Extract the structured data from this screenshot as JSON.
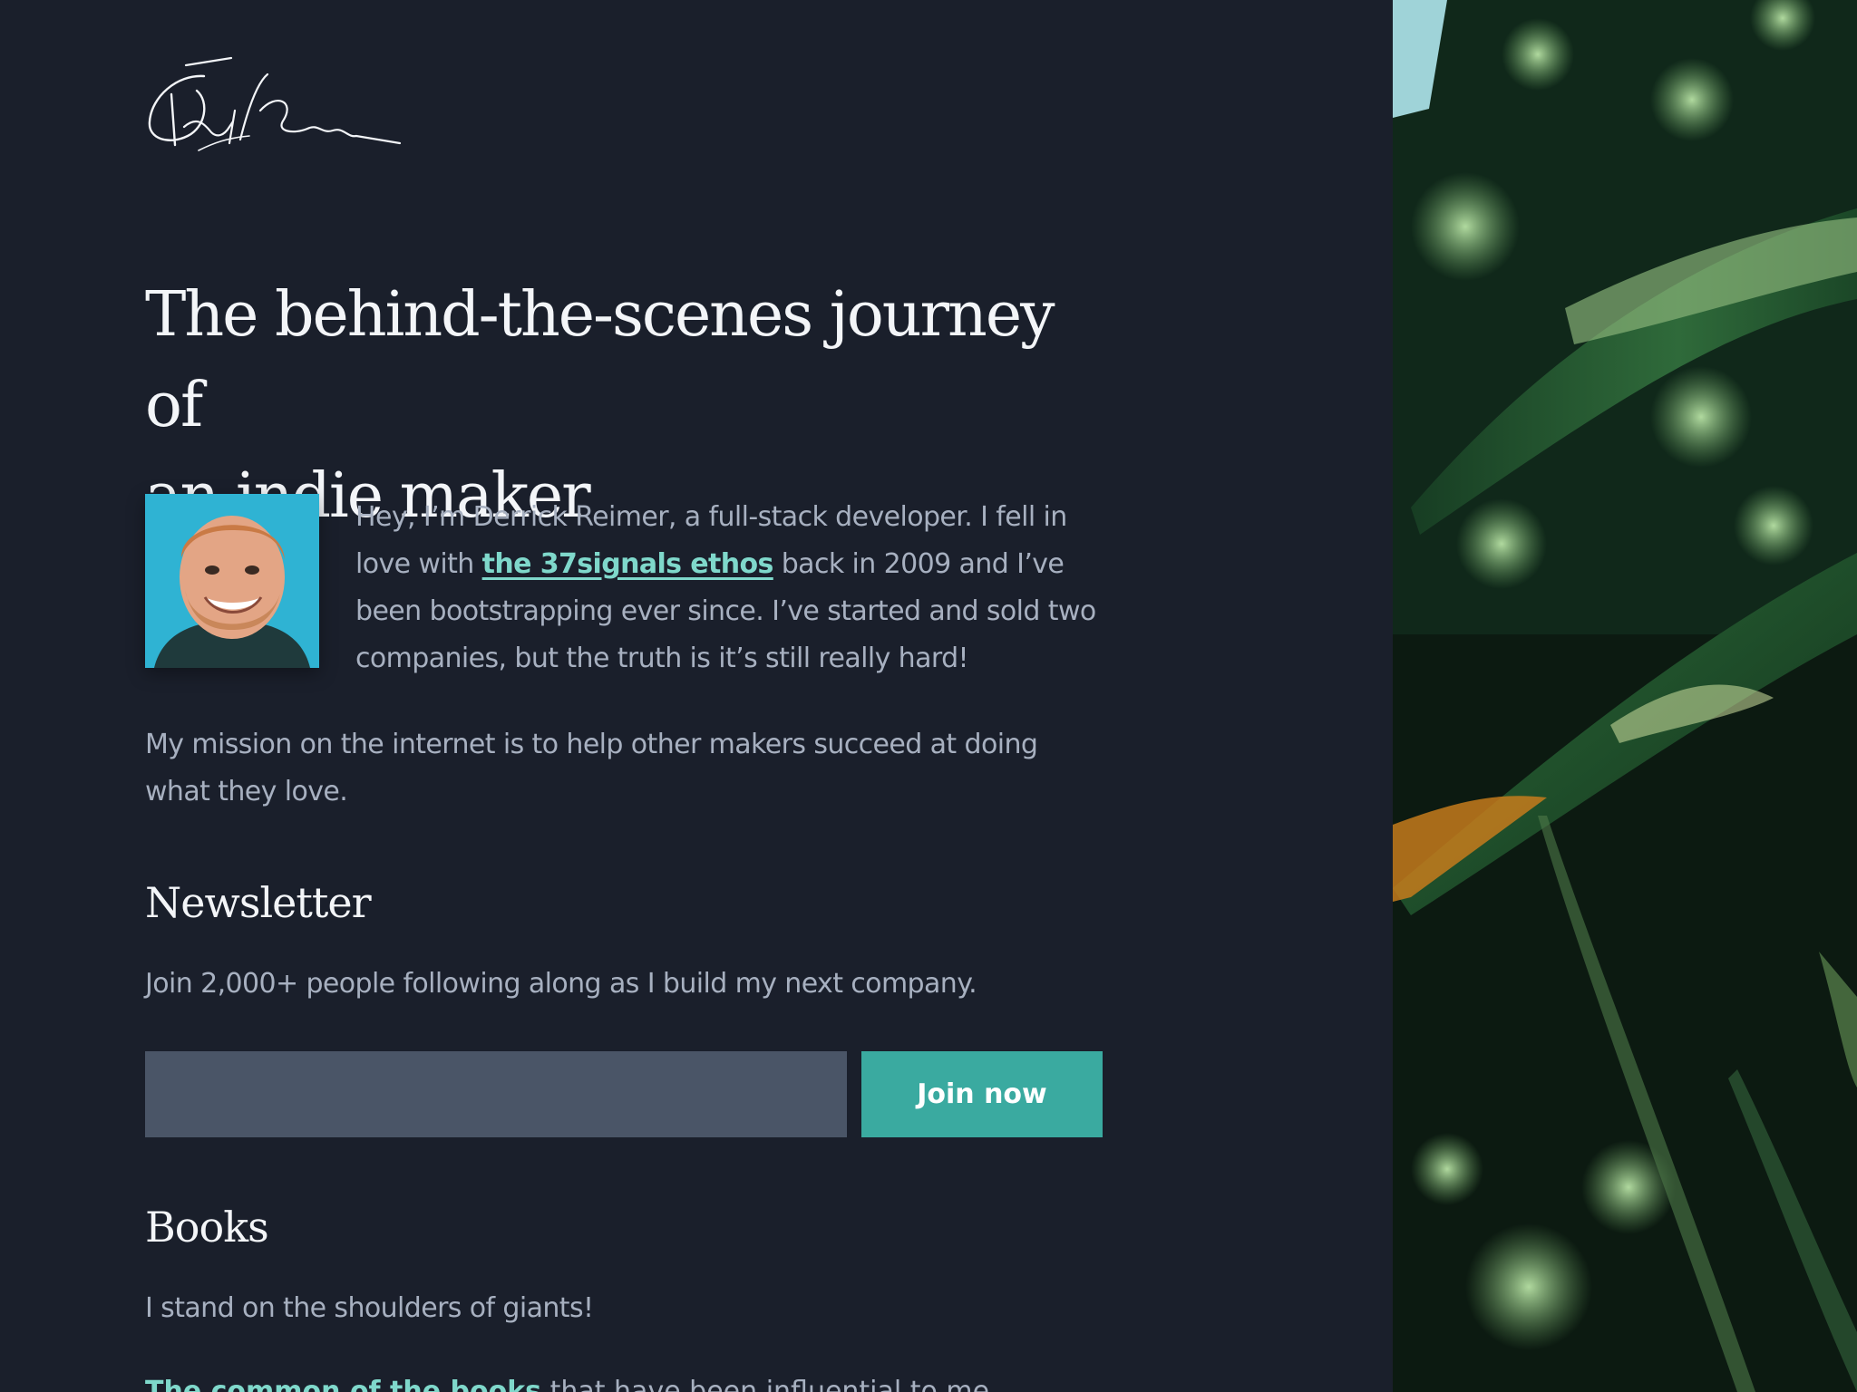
{
  "logo": {
    "signature_text": "Derrick Reimer",
    "icon": "signature-logo"
  },
  "hero": {
    "headline_line1": "The behind-the-scenes journey of",
    "headline_line2": "an indie maker"
  },
  "intro": {
    "avatar_icon": "profile-photo",
    "text_before_link": "Hey, I’m Derrick Reimer, a full-stack developer. I fell in love with ",
    "link_text": "the 37signals ethos",
    "text_after_link": " back in 2009 and I’ve been bootstrapping ever since. I’ve started and sold two companies, but the truth is it’s still really hard!"
  },
  "mission": {
    "text": "My mission on the internet is to help other makers succeed at doing what they love."
  },
  "newsletter": {
    "title": "Newsletter",
    "description": "Join 2,000+ people following along as I build my next company.",
    "email_value": "",
    "button_label": "Join now"
  },
  "books": {
    "title": "Books",
    "description": "I stand on the shoulders of giants!",
    "partial_link": "The common of the books",
    "partial_text": " that have been influential to me"
  },
  "side_image": {
    "icon": "leaf-photo"
  },
  "colors": {
    "background": "#1a1f2b",
    "heading": "#f3f5f8",
    "body_text": "#a7b0c0",
    "link": "#7fd8cb",
    "input_bg": "#4a5567",
    "button_bg": "#3aaaa0"
  }
}
